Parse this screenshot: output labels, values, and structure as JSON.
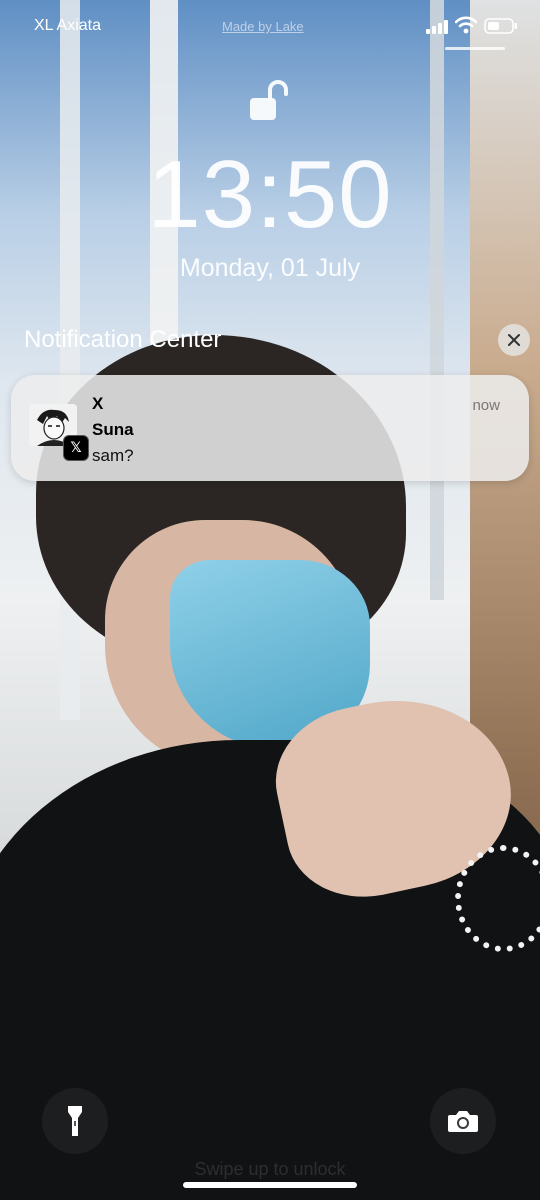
{
  "status_bar": {
    "carrier": "XL Axiata",
    "watermark": "Made by Lake",
    "icons": [
      "cellular-signal-icon",
      "wifi-icon",
      "battery-icon"
    ]
  },
  "lock_screen": {
    "lock_icon": "unlocked-padlock-icon",
    "time": "13:50",
    "date": "Monday, 01 July"
  },
  "notification_center": {
    "title": "Notification Center",
    "close_icon": "close-icon",
    "notifications": [
      {
        "app": "X",
        "sender": "Suna",
        "message": "sam?",
        "time": "now",
        "icon": "x-logo-icon"
      }
    ]
  },
  "bottom": {
    "left_button_icon": "flashlight-icon",
    "right_button_icon": "camera-icon",
    "hint": "Swipe up to unlock"
  },
  "colors": {
    "notification_bg": "#ececec",
    "text_white": "#ffffff"
  }
}
